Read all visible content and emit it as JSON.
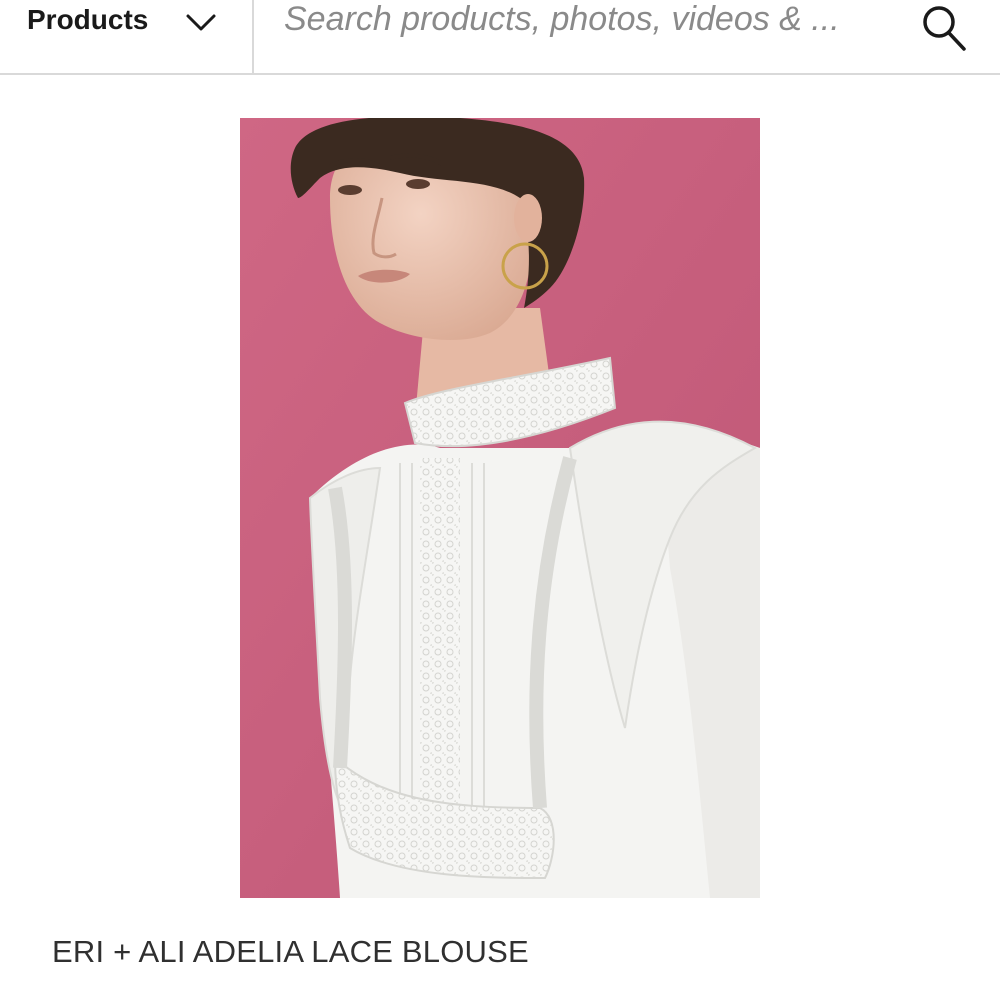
{
  "header": {
    "category_label": "Products",
    "category_icon": "chevron-down-icon",
    "search_placeholder": "Search products, photos, videos & ...",
    "search_value": "",
    "search_icon": "search-icon"
  },
  "product": {
    "image_description_icon": "product-photo",
    "title": "ERI + ALI ADELIA LACE BLOUSE"
  },
  "colors": {
    "background": "#ffffff",
    "photo_backdrop": "#c9607f",
    "blouse": "#f4f4f2",
    "divider": "#d9d9d9",
    "text": "#303030"
  }
}
